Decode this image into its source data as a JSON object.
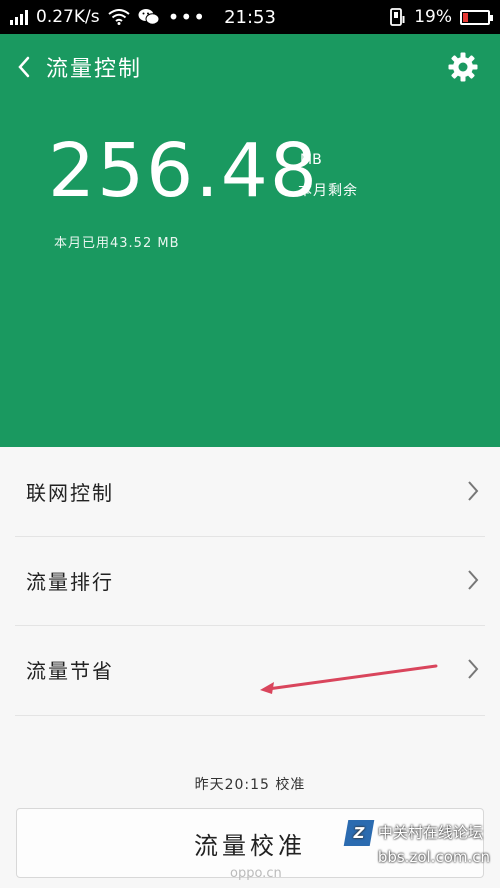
{
  "status_bar": {
    "speed": "0.27K/s",
    "time": "21:53",
    "battery": "19%",
    "battery_level": 0.19,
    "dots": "•••"
  },
  "header": {
    "title": "流量控制",
    "remaining_value": "256.48",
    "unit": "MB",
    "remaining_label": "本月剩余",
    "used_text": "本月已用43.52 MB",
    "bg_color": "#1a9960"
  },
  "menu": {
    "items": [
      {
        "label": "联网控制"
      },
      {
        "label": "流量排行"
      },
      {
        "label": "流量节省"
      }
    ]
  },
  "calibration": {
    "time_text": "昨天20:15 校准",
    "button_label": "流量校准"
  },
  "watermark": {
    "logo": "Z",
    "line1": "中关村在线论坛",
    "line2": "bbs.zol.com.cn",
    "oppo": "oppo.cn"
  }
}
